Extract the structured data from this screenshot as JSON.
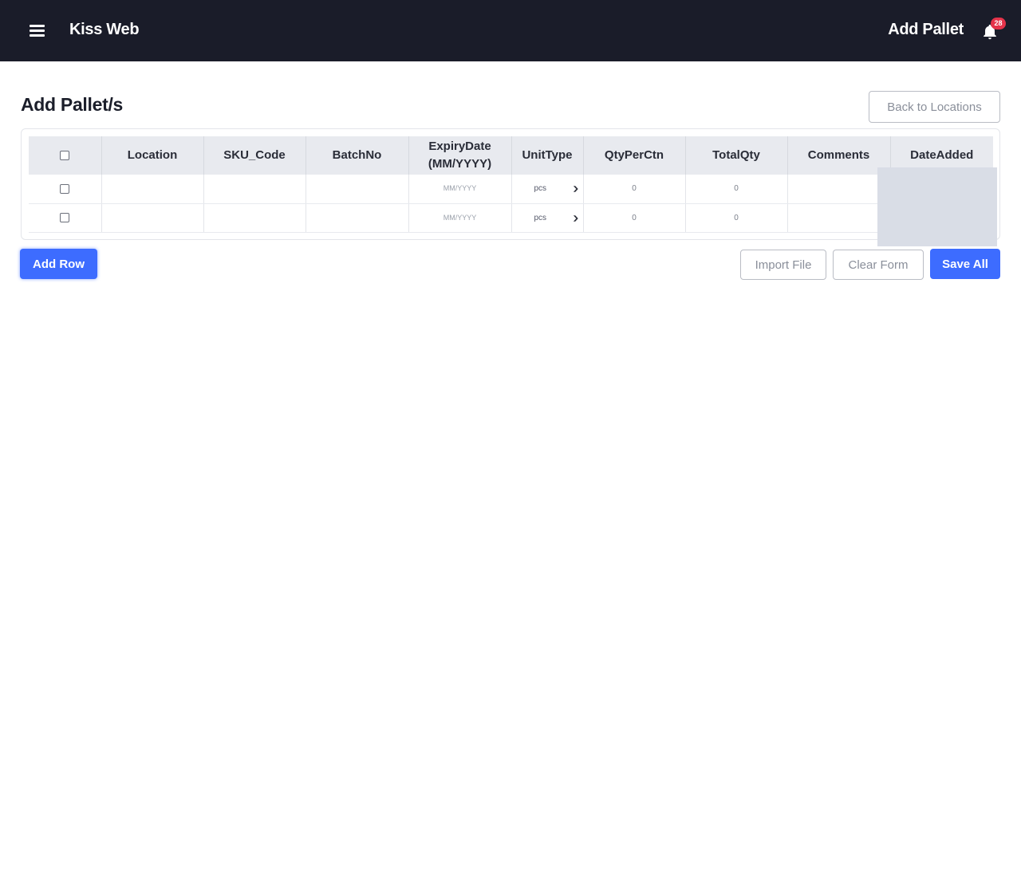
{
  "header": {
    "app_title": "Kiss Web",
    "page_name": "Add Pallet",
    "notifications_count": "28"
  },
  "main": {
    "title": "Add Pallet/s",
    "back_button": "Back to Locations"
  },
  "table": {
    "columns": {
      "location": "Location",
      "sku_code": "SKU_Code",
      "batch_no": "BatchNo",
      "expiry_date_line1": "ExpiryDate",
      "expiry_date_line2": "(MM/YYYY)",
      "unit_type": "UnitType",
      "qty_per_ctn": "QtyPerCtn",
      "total_qty": "TotalQty",
      "comments": "Comments",
      "date_added": "DateAdded"
    },
    "rows": [
      {
        "location": "",
        "sku_code": "",
        "batch_no": "",
        "expiry_placeholder": "MM/YYYY",
        "unit_type": "pcs",
        "qty_per_ctn": "0",
        "total_qty": "0",
        "comments": "",
        "date_added": ""
      },
      {
        "location": "",
        "sku_code": "",
        "batch_no": "",
        "expiry_placeholder": "MM/YYYY",
        "unit_type": "pcs",
        "qty_per_ctn": "0",
        "total_qty": "0",
        "comments": "",
        "date_added": ""
      }
    ]
  },
  "actions": {
    "add_row": "Add Row",
    "import_file": "Import File",
    "clear_form": "Clear Form",
    "save_all": "Save All"
  },
  "colors": {
    "header_bg": "#1a1c29",
    "primary": "#3d6cff",
    "badge": "#e5334a"
  }
}
